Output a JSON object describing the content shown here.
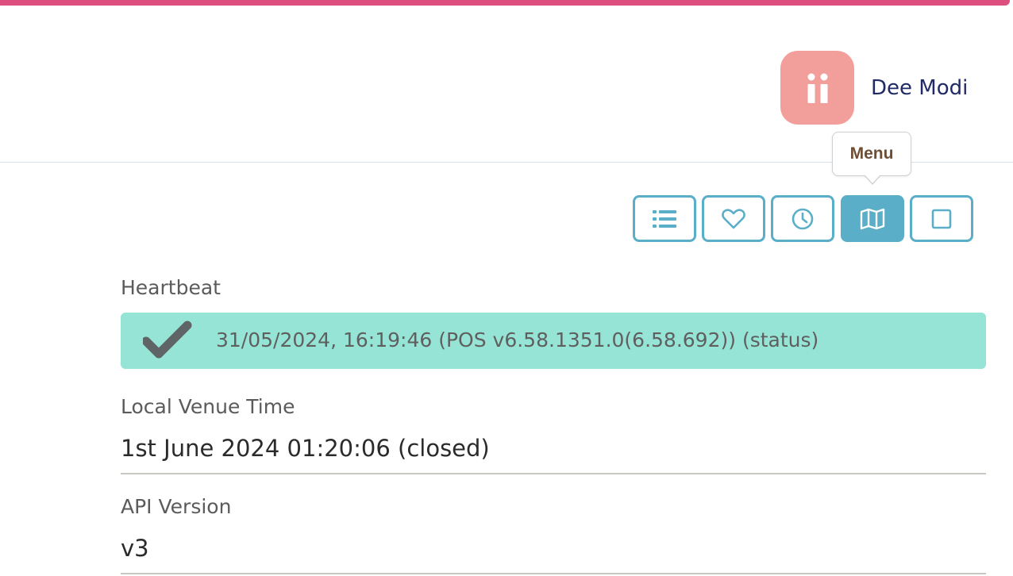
{
  "user": {
    "name": "Dee Modi",
    "avatar_icon": "logo-ii-icon",
    "avatar_color": "#f29e9b"
  },
  "toolbar": {
    "tooltip": "Menu",
    "buttons": [
      {
        "icon": "list-icon",
        "active": false
      },
      {
        "icon": "heart-icon",
        "active": false
      },
      {
        "icon": "clock-icon",
        "active": false
      },
      {
        "icon": "map-icon",
        "active": true
      },
      {
        "icon": "square-icon",
        "active": false
      }
    ],
    "accent_color": "#5aaec8"
  },
  "heartbeat": {
    "label": "Heartbeat",
    "text": "31/05/2024, 16:19:46 (POS v6.58.1351.0(6.58.692))  (status)",
    "status_icon": "check-icon",
    "status_color": "#95e4d6"
  },
  "local_venue_time": {
    "label": "Local Venue Time",
    "value": "1st June 2024 01:20:06 (closed)"
  },
  "api_version": {
    "label": "API Version",
    "value": "v3"
  },
  "colors": {
    "top_bar": "#dd4f7e",
    "user_name": "#1f2a66"
  }
}
